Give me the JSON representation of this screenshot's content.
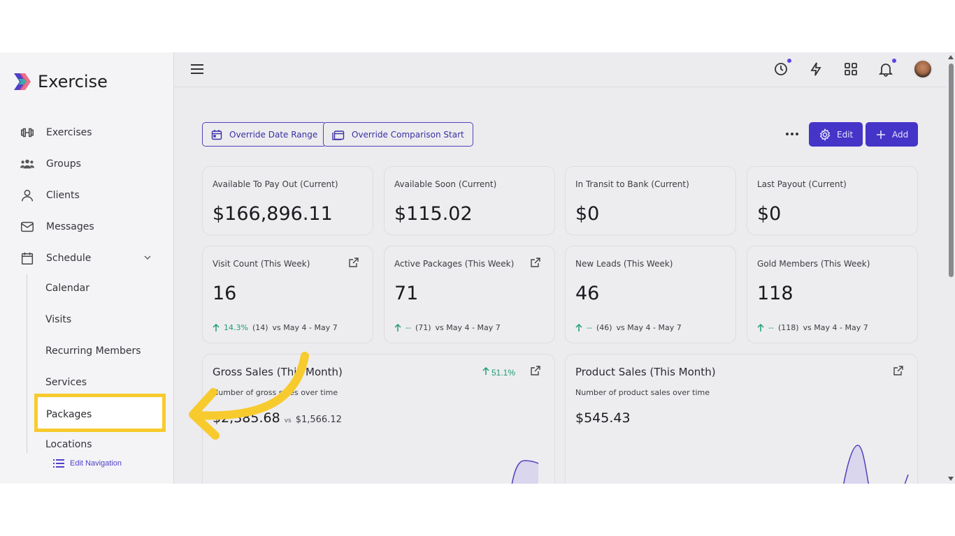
{
  "app": {
    "name": "Exercise"
  },
  "sidebar": {
    "items": [
      {
        "label": "Exercises",
        "icon": "dumbbell-icon"
      },
      {
        "label": "Groups",
        "icon": "users-icon"
      },
      {
        "label": "Clients",
        "icon": "user-icon"
      },
      {
        "label": "Messages",
        "icon": "mail-icon"
      },
      {
        "label": "Schedule",
        "icon": "calendar-icon"
      }
    ],
    "schedule_sub": [
      "Calendar",
      "Visits",
      "Recurring Members",
      "Services",
      "Packages",
      "Locations"
    ],
    "edit_navigation": "Edit Navigation"
  },
  "toolbar": {
    "override_date_range": "Override Date Range",
    "override_comparison_start": "Override Comparison Start",
    "edit": "Edit",
    "add": "Add"
  },
  "cards_row1": [
    {
      "label": "Available To Pay Out (Current)",
      "value": "$166,896.11"
    },
    {
      "label": "Available Soon (Current)",
      "value": "$115.02"
    },
    {
      "label": "In Transit to Bank (Current)",
      "value": "$0"
    },
    {
      "label": "Last Payout (Current)",
      "value": "$0"
    }
  ],
  "cards_row2": [
    {
      "label": "Visit Count (This Week)",
      "value": "16",
      "change": "14.3%",
      "prev": "(14)",
      "range": "vs May 4 - May 7"
    },
    {
      "label": "Active Packages (This Week)",
      "value": "71",
      "change": "--",
      "prev": "(71)",
      "range": "vs May 4 - May 7"
    },
    {
      "label": "New Leads (This Week)",
      "value": "46",
      "change": "--",
      "prev": "(46)",
      "range": "vs May 4 - May 7"
    },
    {
      "label": "Gold Members (This Week)",
      "value": "118",
      "change": "--",
      "prev": "(118)",
      "range": "vs May 4 - May 7"
    }
  ],
  "gross_sales": {
    "title": "Gross Sales (This Month)",
    "subtitle": "Number of gross sales over time",
    "amount": "$2,385.68",
    "vs": "vs",
    "previous": "$1,566.12",
    "change": "51.1%"
  },
  "product_sales": {
    "title": "Product Sales (This Month)",
    "subtitle": "Number of product sales over time",
    "amount": "$545.43"
  },
  "colors": {
    "accent": "#4534c8",
    "highlight": "#f7cb2e",
    "positive": "#1f9d6e"
  }
}
